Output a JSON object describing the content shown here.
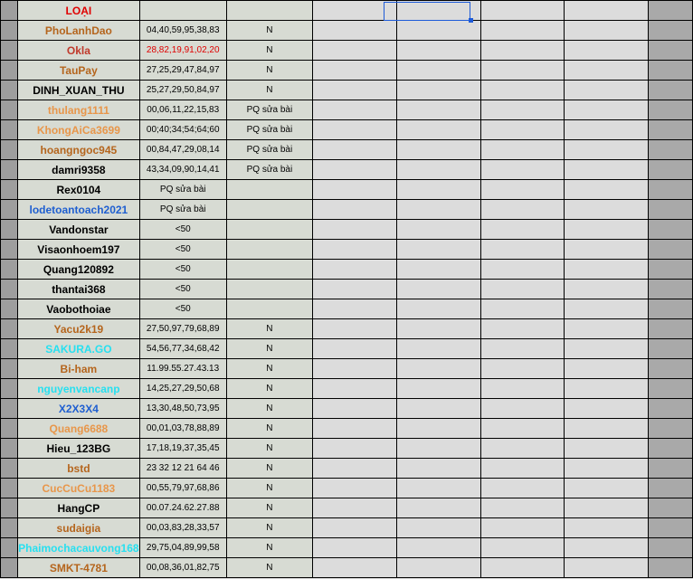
{
  "header": {
    "label": "LOẠI",
    "label_color": "#e00000"
  },
  "rows": [
    {
      "name": "PhoLanhDao",
      "color": "#b5651d",
      "nums": "04,40,59,95,38,83",
      "nums_color": "#000",
      "flag": "N"
    },
    {
      "name": "Okla",
      "color": "#c0392b",
      "nums": "28,82,19,91,02,20",
      "nums_color": "#e00000",
      "flag": "N"
    },
    {
      "name": "TauPay",
      "color": "#b5651d",
      "nums": "27,25,29,47,84,97",
      "nums_color": "#000",
      "flag": "N"
    },
    {
      "name": "DINH_XUAN_THU",
      "color": "#000",
      "nums": "25,27,29,50,84,97",
      "nums_color": "#000",
      "flag": "N"
    },
    {
      "name": "thulang1111",
      "color": "#e8964a",
      "nums": "00,06,11,22,15,83",
      "nums_color": "#000",
      "flag": "PQ sửa bài"
    },
    {
      "name": "KhongAiCa3699",
      "color": "#e8964a",
      "nums": "00;40;34;54;64;60",
      "nums_color": "#000",
      "flag": "PQ sửa bài"
    },
    {
      "name": "hoangngoc945",
      "color": "#b5651d",
      "nums": "00,84,47,29,08,14",
      "nums_color": "#000",
      "flag": "PQ sửa bài"
    },
    {
      "name": "damri9358",
      "color": "#000",
      "nums": "43,34,09,90,14,41",
      "nums_color": "#000",
      "flag": "PQ sửa bài"
    },
    {
      "name": "Rex0104",
      "color": "#000",
      "nums": "PQ sửa bài",
      "nums_color": "#000",
      "flag": ""
    },
    {
      "name": "lodetoantoach2021",
      "color": "#1f5fd1",
      "nums": "PQ sửa bài",
      "nums_color": "#000",
      "flag": ""
    },
    {
      "name": "Vandonstar",
      "color": "#000",
      "nums": "<50",
      "nums_color": "#000",
      "flag": ""
    },
    {
      "name": "Visaonhoem197",
      "color": "#000",
      "nums": "<50",
      "nums_color": "#000",
      "flag": ""
    },
    {
      "name": "Quang120892",
      "color": "#000",
      "nums": "<50",
      "nums_color": "#000",
      "flag": ""
    },
    {
      "name": "thantai368",
      "color": "#000",
      "nums": "<50",
      "nums_color": "#000",
      "flag": ""
    },
    {
      "name": "Vaobothoiae",
      "color": "#000",
      "nums": "<50",
      "nums_color": "#000",
      "flag": ""
    },
    {
      "name": "Yacu2k19",
      "color": "#b5651d",
      "nums": "27,50,97,79,68,89",
      "nums_color": "#000",
      "flag": "N"
    },
    {
      "name": "SAKURA.GO",
      "color": "#27e0f0",
      "nums": "54,56,77,34,68,42",
      "nums_color": "#000",
      "flag": "N"
    },
    {
      "name": "Bi-ham",
      "color": "#b5651d",
      "nums": "11.99.55.27.43.13",
      "nums_color": "#000",
      "flag": "N"
    },
    {
      "name": "nguyenvancanp",
      "color": "#27e0f0",
      "nums": "14,25,27,29,50,68",
      "nums_color": "#000",
      "flag": "N"
    },
    {
      "name": "X2X3X4",
      "color": "#1f5fd1",
      "nums": "13,30,48,50,73,95",
      "nums_color": "#000",
      "flag": "N"
    },
    {
      "name": "Quang6688",
      "color": "#e8964a",
      "nums": "00,01,03,78,88,89",
      "nums_color": "#000",
      "flag": "N"
    },
    {
      "name": "Hieu_123BG",
      "color": "#000",
      "nums": "17,18,19,37,35,45",
      "nums_color": "#000",
      "flag": "N"
    },
    {
      "name": "bstd",
      "color": "#b5651d",
      "nums": "23 32 12 21 64 46",
      "nums_color": "#000",
      "flag": "N"
    },
    {
      "name": "CucCuCu1183",
      "color": "#e8964a",
      "nums": "00,55,79,97,68,86",
      "nums_color": "#000",
      "flag": "N"
    },
    {
      "name": "HangCP",
      "color": "#000",
      "nums": "00.07.24.62.27.88",
      "nums_color": "#000",
      "flag": "N"
    },
    {
      "name": "sudaigia",
      "color": "#b5651d",
      "nums": "00,03,83,28,33,57",
      "nums_color": "#000",
      "flag": "N"
    },
    {
      "name": "Phaimochacauvong168",
      "color": "#27e0f0",
      "nums": "29,75,04,89,99,58",
      "nums_color": "#000",
      "flag": "N"
    },
    {
      "name": "SMKT-4781",
      "color": "#b5651d",
      "nums": "00,08,36,01,82,75",
      "nums_color": "#000",
      "flag": "N"
    }
  ]
}
